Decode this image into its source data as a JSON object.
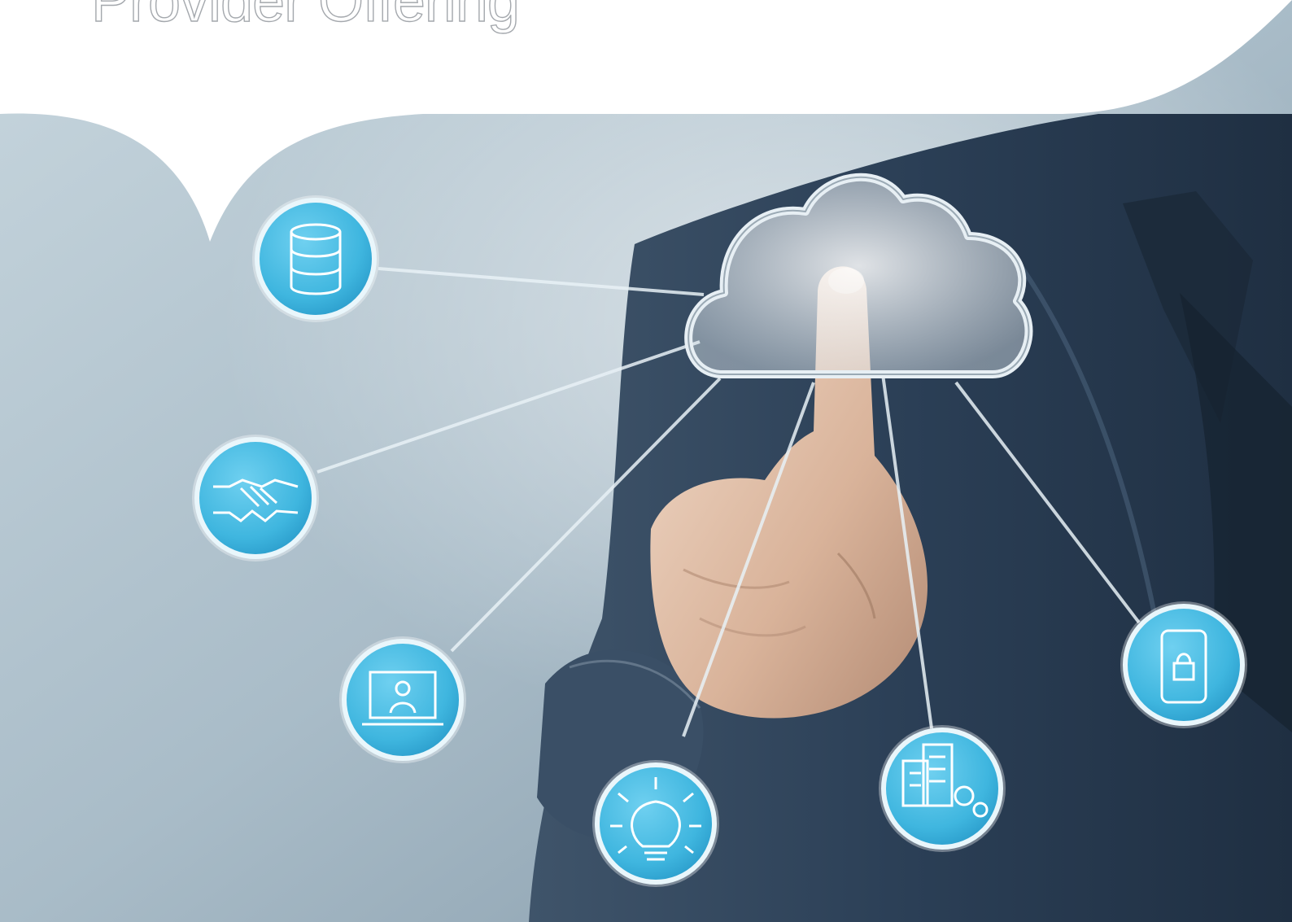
{
  "page": {
    "title": "Provider Offering"
  },
  "illustration": {
    "hub_icon": "cloud-icon",
    "node_icons": [
      "database-icon",
      "handshake-icon",
      "laptop-user-icon",
      "lightbulb-icon",
      "buildings-gears-icon",
      "mobile-lock-icon"
    ],
    "node_color": "#3fb6df",
    "background_color": "#b9ccd6",
    "suit_color": "#2b3f56"
  }
}
